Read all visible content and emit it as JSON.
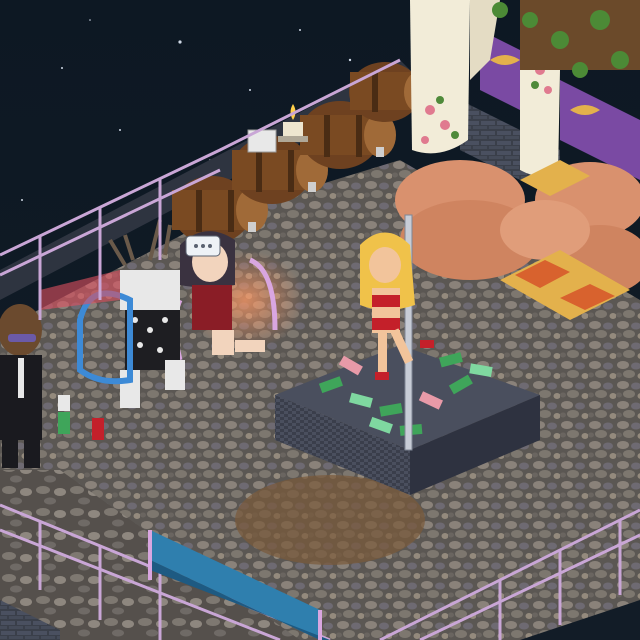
{
  "scene": {
    "game": "isometric-hotel-room",
    "visible_text": []
  },
  "palette": {
    "sky": "#0b1520",
    "stars": "#cfd8e6",
    "floor_stone": "#6f6a66",
    "railing": "#c9a6d6",
    "curtain": "#f2ecd8",
    "cushion": "#d9916e",
    "rug_gold": "#e3b14c",
    "banner_purple": "#7a4aa3",
    "stage_dark": "#2e3240",
    "barrel": "#7a4a22",
    "bench_blue": "#2f7fae",
    "money": "#3fa55a"
  },
  "entities": [
    {
      "name": "dancer-avatar",
      "hair": "blonde",
      "outfit": "red-bikini"
    },
    {
      "name": "seated-avatar-dark-hair",
      "outfit": "red-dress"
    },
    {
      "name": "robot-reindeer-avatar",
      "outfit": "spotted-suit"
    },
    {
      "name": "suit-sunglasses-avatar",
      "outfit": "black-suit"
    }
  ],
  "props": [
    "dance-pole",
    "money-stage",
    "wine-barrels",
    "candle",
    "cushion-lounge",
    "floor-rug",
    "purple-banners",
    "white-curtains",
    "pink-railing",
    "blue-bench",
    "soda-cans",
    "speech-bubble-icon"
  ]
}
